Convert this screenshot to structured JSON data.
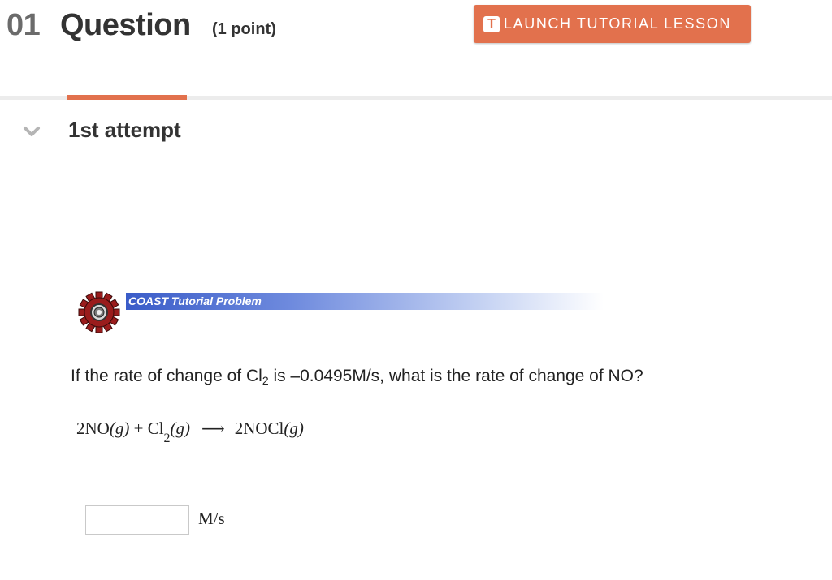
{
  "header": {
    "question_number": "01",
    "question_title": "Question",
    "points": "(1 point)",
    "launch_button": {
      "icon_letter": "T",
      "label": "LAUNCH TUTORIAL LESSON"
    }
  },
  "attempt": {
    "title": "1st attempt",
    "chevron_icon": "chevron-down-icon"
  },
  "tutorial": {
    "banner_label": "COAST Tutorial Problem",
    "gear_icon": "gear-icon"
  },
  "question": {
    "prefix": "If the rate of change of Cl",
    "subscript": "2",
    "suffix": " is –0.0495M/s, what is the rate of change of NO?"
  },
  "equation": {
    "reactant1": "2NO",
    "state1": "(g)",
    "plus": " + ",
    "reactant2": "Cl",
    "reactant2_sub": "2",
    "state2": "(g)",
    "arrow": "⟶",
    "product": "2NOCl",
    "state3": "(g)"
  },
  "answer": {
    "value": "",
    "unit": "M/s"
  },
  "colors": {
    "accent": "#e2714d",
    "banner_blue": "#3a5cc8",
    "divider": "#ececec"
  }
}
